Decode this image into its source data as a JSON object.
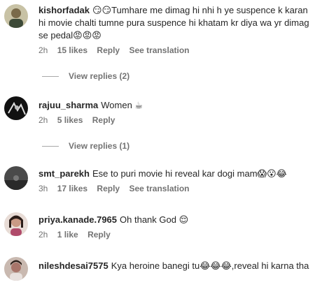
{
  "comments": [
    {
      "username": "kishorfadak",
      "text": "😏😏Tumhare me dimag hi nhi h ye suspence k karan hi movie chalti tumne pura suspence hi khatam kr diya wa yr dimag se pedal😡😡😡",
      "time": "2h",
      "likes": "15 likes",
      "reply": "Reply",
      "translation": "See translation",
      "view_replies": "View replies (2)"
    },
    {
      "username": "rajuu_sharma",
      "text": "Women ☕",
      "time": "2h",
      "likes": "5 likes",
      "reply": "Reply",
      "view_replies": "View replies (1)"
    },
    {
      "username": "smt_parekh",
      "text": "Ese to puri movie hi reveal kar dogi mam😱😮😂",
      "time": "3h",
      "likes": "17 likes",
      "reply": "Reply",
      "translation": "See translation"
    },
    {
      "username": "priya.kanade.7965",
      "text": "Oh thank God 😌",
      "time": "2h",
      "likes": "1 like",
      "reply": "Reply"
    },
    {
      "username": "nileshdesai7575",
      "text": "Kya heroine banegi tu😂😂😂,reveal hi karna tha"
    }
  ],
  "colors": {
    "text": "#262626",
    "secondary": "#737373",
    "divider": "#a8a8a8"
  },
  "icons": [
    "avatar-photo"
  ]
}
